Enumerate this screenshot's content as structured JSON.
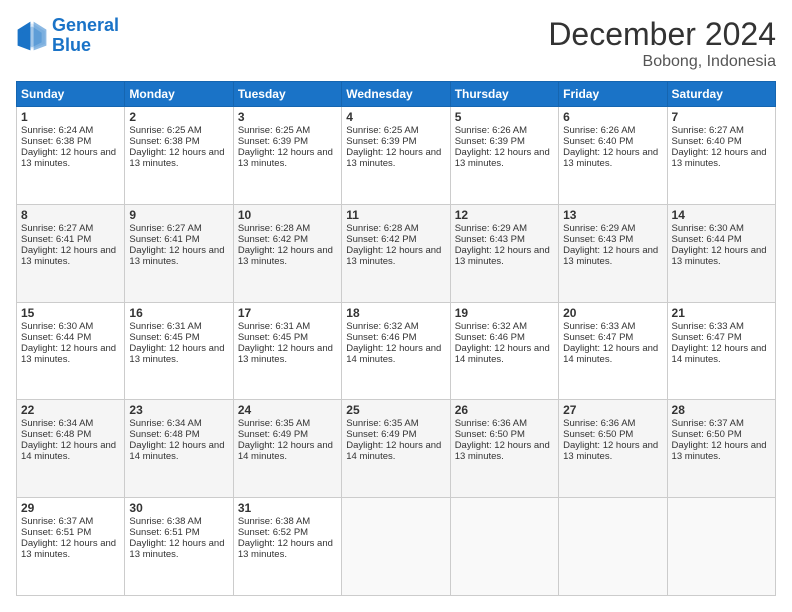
{
  "header": {
    "logo_line1": "General",
    "logo_line2": "Blue",
    "month_title": "December 2024",
    "location": "Bobong, Indonesia"
  },
  "days_of_week": [
    "Sunday",
    "Monday",
    "Tuesday",
    "Wednesday",
    "Thursday",
    "Friday",
    "Saturday"
  ],
  "weeks": [
    [
      {
        "day": "1",
        "sunrise": "Sunrise: 6:24 AM",
        "sunset": "Sunset: 6:38 PM",
        "daylight": "Daylight: 12 hours and 13 minutes."
      },
      {
        "day": "2",
        "sunrise": "Sunrise: 6:25 AM",
        "sunset": "Sunset: 6:38 PM",
        "daylight": "Daylight: 12 hours and 13 minutes."
      },
      {
        "day": "3",
        "sunrise": "Sunrise: 6:25 AM",
        "sunset": "Sunset: 6:39 PM",
        "daylight": "Daylight: 12 hours and 13 minutes."
      },
      {
        "day": "4",
        "sunrise": "Sunrise: 6:25 AM",
        "sunset": "Sunset: 6:39 PM",
        "daylight": "Daylight: 12 hours and 13 minutes."
      },
      {
        "day": "5",
        "sunrise": "Sunrise: 6:26 AM",
        "sunset": "Sunset: 6:39 PM",
        "daylight": "Daylight: 12 hours and 13 minutes."
      },
      {
        "day": "6",
        "sunrise": "Sunrise: 6:26 AM",
        "sunset": "Sunset: 6:40 PM",
        "daylight": "Daylight: 12 hours and 13 minutes."
      },
      {
        "day": "7",
        "sunrise": "Sunrise: 6:27 AM",
        "sunset": "Sunset: 6:40 PM",
        "daylight": "Daylight: 12 hours and 13 minutes."
      }
    ],
    [
      {
        "day": "8",
        "sunrise": "Sunrise: 6:27 AM",
        "sunset": "Sunset: 6:41 PM",
        "daylight": "Daylight: 12 hours and 13 minutes."
      },
      {
        "day": "9",
        "sunrise": "Sunrise: 6:27 AM",
        "sunset": "Sunset: 6:41 PM",
        "daylight": "Daylight: 12 hours and 13 minutes."
      },
      {
        "day": "10",
        "sunrise": "Sunrise: 6:28 AM",
        "sunset": "Sunset: 6:42 PM",
        "daylight": "Daylight: 12 hours and 13 minutes."
      },
      {
        "day": "11",
        "sunrise": "Sunrise: 6:28 AM",
        "sunset": "Sunset: 6:42 PM",
        "daylight": "Daylight: 12 hours and 13 minutes."
      },
      {
        "day": "12",
        "sunrise": "Sunrise: 6:29 AM",
        "sunset": "Sunset: 6:43 PM",
        "daylight": "Daylight: 12 hours and 13 minutes."
      },
      {
        "day": "13",
        "sunrise": "Sunrise: 6:29 AM",
        "sunset": "Sunset: 6:43 PM",
        "daylight": "Daylight: 12 hours and 13 minutes."
      },
      {
        "day": "14",
        "sunrise": "Sunrise: 6:30 AM",
        "sunset": "Sunset: 6:44 PM",
        "daylight": "Daylight: 12 hours and 13 minutes."
      }
    ],
    [
      {
        "day": "15",
        "sunrise": "Sunrise: 6:30 AM",
        "sunset": "Sunset: 6:44 PM",
        "daylight": "Daylight: 12 hours and 13 minutes."
      },
      {
        "day": "16",
        "sunrise": "Sunrise: 6:31 AM",
        "sunset": "Sunset: 6:45 PM",
        "daylight": "Daylight: 12 hours and 13 minutes."
      },
      {
        "day": "17",
        "sunrise": "Sunrise: 6:31 AM",
        "sunset": "Sunset: 6:45 PM",
        "daylight": "Daylight: 12 hours and 13 minutes."
      },
      {
        "day": "18",
        "sunrise": "Sunrise: 6:32 AM",
        "sunset": "Sunset: 6:46 PM",
        "daylight": "Daylight: 12 hours and 14 minutes."
      },
      {
        "day": "19",
        "sunrise": "Sunrise: 6:32 AM",
        "sunset": "Sunset: 6:46 PM",
        "daylight": "Daylight: 12 hours and 14 minutes."
      },
      {
        "day": "20",
        "sunrise": "Sunrise: 6:33 AM",
        "sunset": "Sunset: 6:47 PM",
        "daylight": "Daylight: 12 hours and 14 minutes."
      },
      {
        "day": "21",
        "sunrise": "Sunrise: 6:33 AM",
        "sunset": "Sunset: 6:47 PM",
        "daylight": "Daylight: 12 hours and 14 minutes."
      }
    ],
    [
      {
        "day": "22",
        "sunrise": "Sunrise: 6:34 AM",
        "sunset": "Sunset: 6:48 PM",
        "daylight": "Daylight: 12 hours and 14 minutes."
      },
      {
        "day": "23",
        "sunrise": "Sunrise: 6:34 AM",
        "sunset": "Sunset: 6:48 PM",
        "daylight": "Daylight: 12 hours and 14 minutes."
      },
      {
        "day": "24",
        "sunrise": "Sunrise: 6:35 AM",
        "sunset": "Sunset: 6:49 PM",
        "daylight": "Daylight: 12 hours and 14 minutes."
      },
      {
        "day": "25",
        "sunrise": "Sunrise: 6:35 AM",
        "sunset": "Sunset: 6:49 PM",
        "daylight": "Daylight: 12 hours and 14 minutes."
      },
      {
        "day": "26",
        "sunrise": "Sunrise: 6:36 AM",
        "sunset": "Sunset: 6:50 PM",
        "daylight": "Daylight: 12 hours and 13 minutes."
      },
      {
        "day": "27",
        "sunrise": "Sunrise: 6:36 AM",
        "sunset": "Sunset: 6:50 PM",
        "daylight": "Daylight: 12 hours and 13 minutes."
      },
      {
        "day": "28",
        "sunrise": "Sunrise: 6:37 AM",
        "sunset": "Sunset: 6:50 PM",
        "daylight": "Daylight: 12 hours and 13 minutes."
      }
    ],
    [
      {
        "day": "29",
        "sunrise": "Sunrise: 6:37 AM",
        "sunset": "Sunset: 6:51 PM",
        "daylight": "Daylight: 12 hours and 13 minutes."
      },
      {
        "day": "30",
        "sunrise": "Sunrise: 6:38 AM",
        "sunset": "Sunset: 6:51 PM",
        "daylight": "Daylight: 12 hours and 13 minutes."
      },
      {
        "day": "31",
        "sunrise": "Sunrise: 6:38 AM",
        "sunset": "Sunset: 6:52 PM",
        "daylight": "Daylight: 12 hours and 13 minutes."
      },
      null,
      null,
      null,
      null
    ]
  ]
}
